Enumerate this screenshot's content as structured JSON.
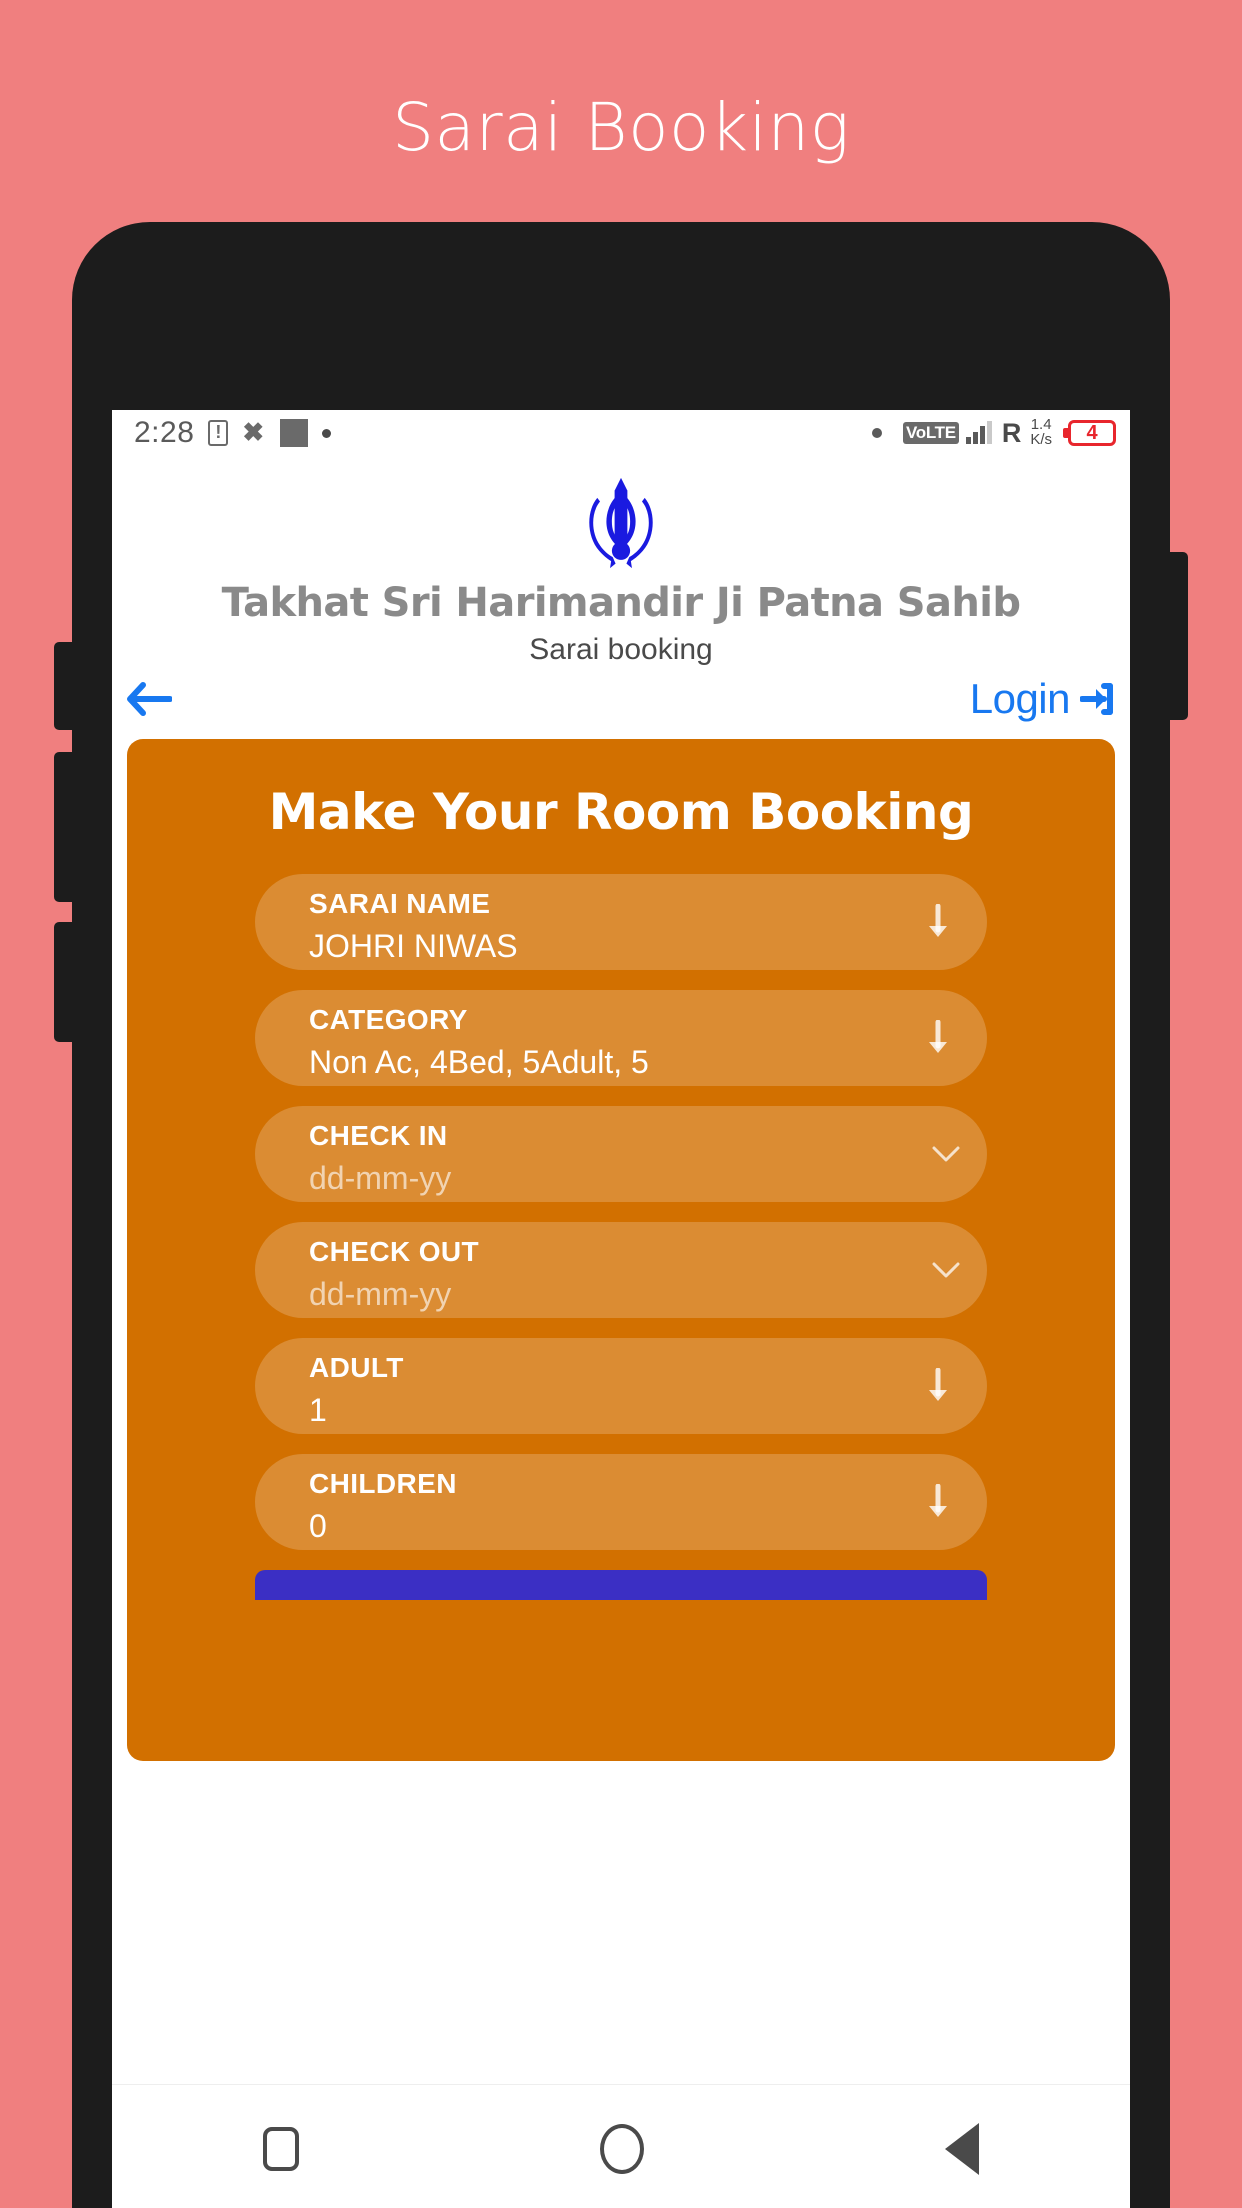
{
  "promo": {
    "title": "Sarai Booking"
  },
  "status_bar": {
    "time": "2:28",
    "clipboard_icon": "clipboard-alert-icon",
    "bowtie_icon": "bowtie-icon",
    "square_icon": "square-icon",
    "dot_icon": "dot-icon",
    "right_dot_icon": "dot-icon",
    "volte_label": "VoLTE",
    "signal_icon": "signal-bars-icon",
    "roaming_label": "R",
    "data_speed_value": "1.4",
    "data_speed_unit": "K/s",
    "battery_level": "4"
  },
  "app_header": {
    "logo_icon": "khanda-icon",
    "logo_color": "#1a1ae0",
    "org_title": "Takhat Sri Harimandir Ji Patna Sahib",
    "org_subtitle": "Sarai booking",
    "back_icon": "arrow-left-icon",
    "login_label": "Login",
    "login_icon": "sign-in-icon",
    "accent_color": "#1878f0"
  },
  "booking_card": {
    "background_color": "#d27000",
    "title": "Make Your Room Booking",
    "fields": [
      {
        "name": "sarai-name",
        "label": "SARAI NAME",
        "value": "JOHRI NIWAS",
        "placeholder": "",
        "icon": "arrow-down-icon"
      },
      {
        "name": "category",
        "label": "CATEGORY",
        "value": "Non Ac, 4Bed, 5Adult, 5",
        "placeholder": "",
        "icon": "arrow-down-icon"
      },
      {
        "name": "check-in",
        "label": "CHECK IN",
        "value": "dd-mm-yy",
        "is_placeholder": true,
        "icon": "chevron-down-icon"
      },
      {
        "name": "check-out",
        "label": "CHECK OUT",
        "value": "dd-mm-yy",
        "is_placeholder": true,
        "icon": "chevron-down-icon"
      },
      {
        "name": "adult",
        "label": "ADULT",
        "value": "1",
        "placeholder": "",
        "icon": "arrow-down-icon"
      },
      {
        "name": "children",
        "label": "CHILDREN",
        "value": "0",
        "placeholder": "",
        "icon": "arrow-down-icon"
      }
    ],
    "submit_button_color": "#3b2fc4"
  },
  "nav_bar": {
    "recents_icon": "square-recents-icon",
    "home_icon": "circle-home-icon",
    "back_icon": "triangle-back-icon"
  }
}
